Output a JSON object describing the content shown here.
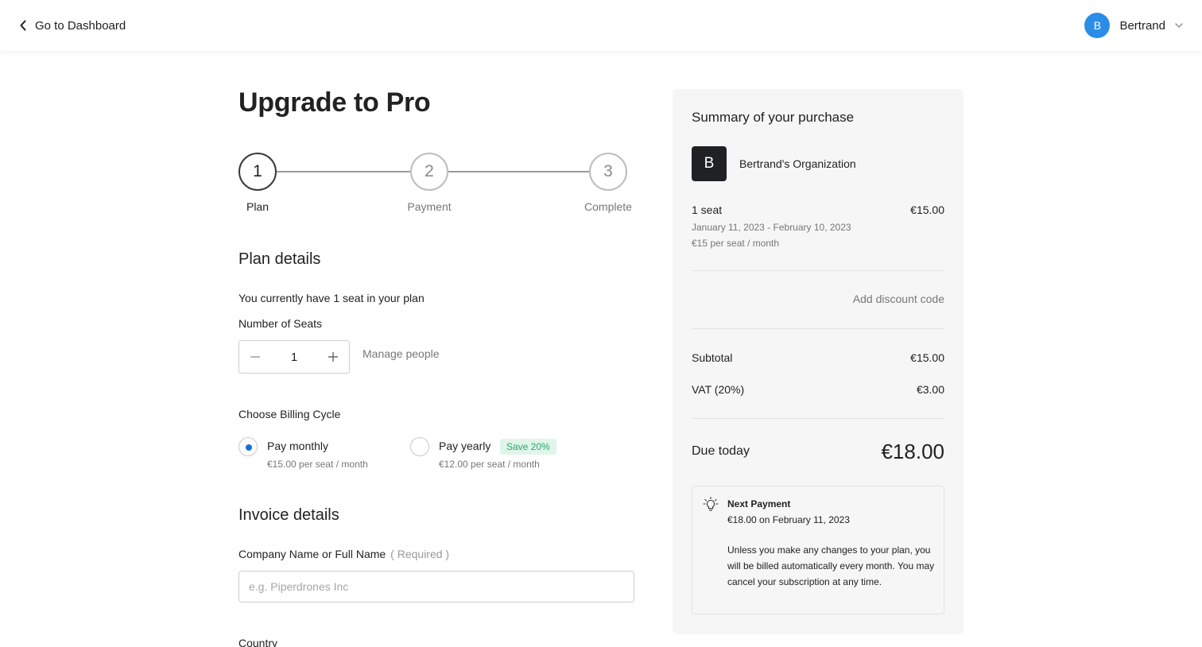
{
  "header": {
    "back_label": "Go to Dashboard",
    "user": {
      "initial": "B",
      "name": "Bertrand"
    }
  },
  "page": {
    "title": "Upgrade to Pro"
  },
  "steps": [
    {
      "number": "1",
      "label": "Plan",
      "state": "active"
    },
    {
      "number": "2",
      "label": "Payment",
      "state": "inactive"
    },
    {
      "number": "3",
      "label": "Complete",
      "state": "inactive"
    }
  ],
  "plan_details": {
    "title": "Plan details",
    "current_seats_text": "You currently have 1 seat in your plan",
    "seats_label": "Number of Seats",
    "seats_value": "1",
    "manage_people_label": "Manage people"
  },
  "billing": {
    "title": "Choose Billing Cycle",
    "options": [
      {
        "label": "Pay monthly",
        "price": "€15.00 per seat / month",
        "selected": true
      },
      {
        "label": "Pay yearly",
        "price": "€12.00 per seat / month",
        "selected": false,
        "badge": "Save 20%"
      }
    ]
  },
  "invoice": {
    "title": "Invoice details",
    "company_label": "Company Name or Full Name",
    "company_required": "( Required )",
    "company_placeholder": "e.g. Piperdrones Inc",
    "country_label": "Country"
  },
  "summary": {
    "title": "Summary of your purchase",
    "org_initial": "B",
    "org_name": "Bertrand's Organization",
    "seat_label": "1 seat",
    "seat_price": "€15.00",
    "period": "January 11, 2023 - February 10, 2023",
    "rate": "€15 per seat / month",
    "discount_label": "Add discount code",
    "subtotal_label": "Subtotal",
    "subtotal_value": "€15.00",
    "vat_label": "VAT (20%)",
    "vat_value": "€3.00",
    "due_label": "Due today",
    "due_value": "€18.00",
    "next_payment": {
      "title": "Next Payment",
      "amount": "€18.00 on February 11, 2023",
      "note": "Unless you make any changes to your plan, you will be billed automatically every month. You may cancel your subscription at any time."
    }
  },
  "colors": {
    "accent": "#1b6fd6",
    "avatar": "#2b8de6",
    "badge_bg": "#dff5ea",
    "badge_text": "#28a66a",
    "panel_bg": "#f6f6f7"
  },
  "icons": [
    "chevron-left-icon",
    "chevron-down-icon",
    "minus-icon",
    "plus-icon",
    "lightbulb-icon"
  ]
}
